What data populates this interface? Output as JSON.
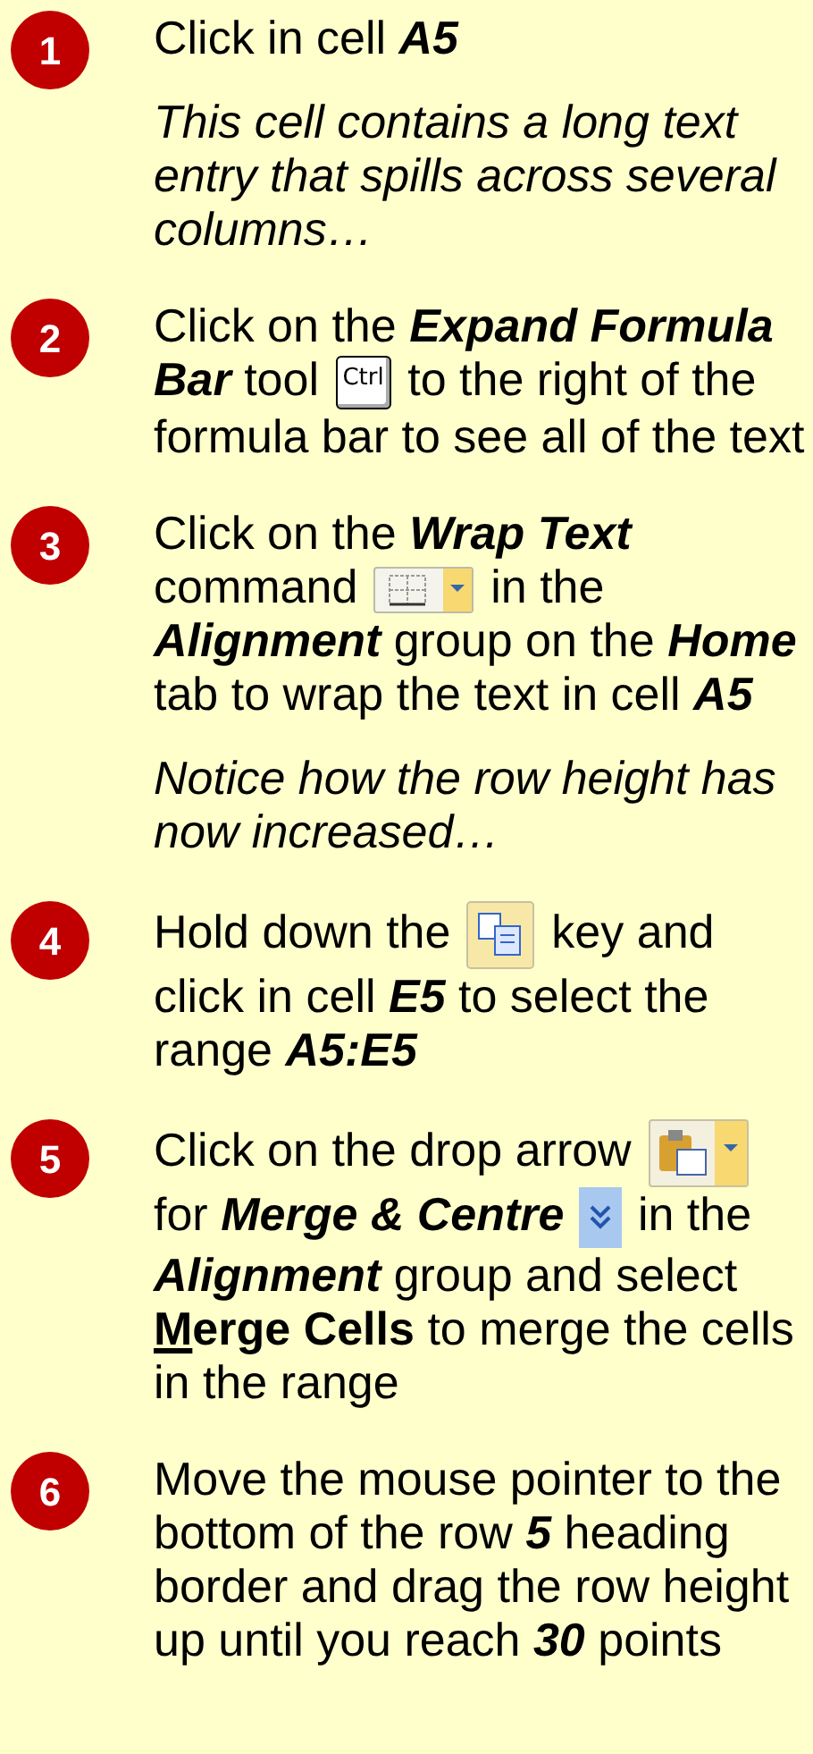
{
  "steps": [
    {
      "number": "1",
      "paragraphs": [
        {
          "italic": false,
          "parts": [
            {
              "kind": "text",
              "text": "Click in cell "
            },
            {
              "kind": "emphasis",
              "text": "A5"
            }
          ]
        },
        {
          "italic": true,
          "parts": [
            {
              "kind": "text",
              "text": "This cell contains a long text entry that spills across several columns…"
            }
          ]
        }
      ]
    },
    {
      "number": "2",
      "paragraphs": [
        {
          "italic": false,
          "parts": [
            {
              "kind": "text",
              "text": "Click on the "
            },
            {
              "kind": "emphasis",
              "text": "Expand Formula Bar"
            },
            {
              "kind": "text",
              "text": " tool "
            },
            {
              "kind": "key",
              "text": "Ctrl"
            },
            {
              "kind": "text",
              "text": " to the right of the formula bar to see all of the text"
            }
          ]
        }
      ]
    },
    {
      "number": "3",
      "paragraphs": [
        {
          "italic": false,
          "parts": [
            {
              "kind": "text",
              "text": "Click on the "
            },
            {
              "kind": "emphasis",
              "text": "Wrap Text"
            },
            {
              "kind": "text",
              "text": " command "
            },
            {
              "kind": "wrap-icon"
            },
            {
              "kind": "text",
              "text": " in the "
            },
            {
              "kind": "emphasis",
              "text": "Alignment"
            },
            {
              "kind": "text",
              "text": " group on the "
            },
            {
              "kind": "emphasis",
              "text": "Home"
            },
            {
              "kind": "text",
              "text": " tab to wrap the text in cell "
            },
            {
              "kind": "emphasis",
              "text": "A5"
            }
          ]
        },
        {
          "italic": true,
          "parts": [
            {
              "kind": "text",
              "text": "Notice how the row height has now increased…"
            }
          ]
        }
      ]
    },
    {
      "number": "4",
      "paragraphs": [
        {
          "italic": false,
          "parts": [
            {
              "kind": "text",
              "text": "Hold down the "
            },
            {
              "kind": "copy-icon"
            },
            {
              "kind": "text",
              "text": " key and click in cell "
            },
            {
              "kind": "emphasis",
              "text": "E5"
            },
            {
              "kind": "text",
              "text": " to select the range "
            },
            {
              "kind": "emphasis",
              "text": "A5:E5"
            }
          ]
        }
      ]
    },
    {
      "number": "5",
      "paragraphs": [
        {
          "italic": false,
          "parts": [
            {
              "kind": "text",
              "text": "Click on the drop arrow "
            },
            {
              "kind": "paste-icon"
            },
            {
              "kind": "text",
              "text": " for "
            },
            {
              "kind": "emphasis",
              "text": "Merge & Centre"
            },
            {
              "kind": "expand-icon"
            },
            {
              "kind": "text",
              "text": " in the "
            },
            {
              "kind": "emphasis",
              "text": "Alignment"
            },
            {
              "kind": "text",
              "text": " group and select "
            },
            {
              "kind": "accelerator",
              "text": "M"
            },
            {
              "kind": "strong",
              "text": "erge Cells"
            },
            {
              "kind": "text",
              "text": " to merge the cells in the range"
            }
          ]
        }
      ]
    },
    {
      "number": "6",
      "paragraphs": [
        {
          "italic": false,
          "parts": [
            {
              "kind": "text",
              "text": "Move the mouse pointer to the bottom of the row "
            },
            {
              "kind": "emphasis",
              "text": "5"
            },
            {
              "kind": "text",
              "text": " heading border and drag the row height up until you reach "
            },
            {
              "kind": "emphasis",
              "text": "30"
            },
            {
              "kind": "text",
              "text": " points"
            }
          ]
        }
      ]
    }
  ]
}
